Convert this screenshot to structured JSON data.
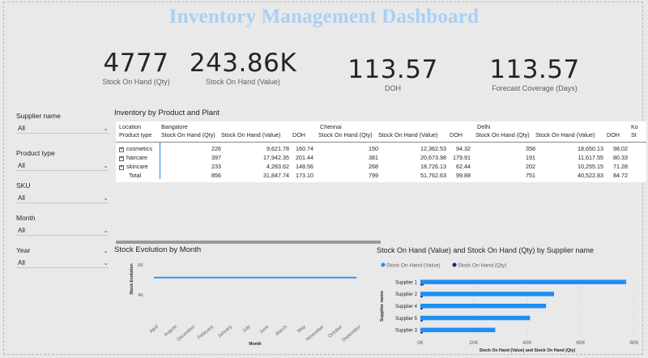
{
  "title": "Inventory Management Dashboard",
  "kpis": [
    {
      "value": "4777",
      "label": "Stock On Hand (Qty)"
    },
    {
      "value": "243.86K",
      "label": "Stock On Hand (Value)"
    },
    {
      "value": "113.57",
      "label": "DOH"
    },
    {
      "value": "113.57",
      "label": "Forecast Coverage (Days)"
    }
  ],
  "slicers": [
    {
      "label": "Supplier name",
      "value": "All"
    },
    {
      "label": "Product type",
      "value": "All"
    },
    {
      "label": "SKU",
      "value": "All"
    },
    {
      "label": "Month",
      "value": "All"
    },
    {
      "label": "Year",
      "value": "All"
    }
  ],
  "matrix": {
    "title": "Inventory by Product and Plant",
    "row_header_top": "Location",
    "row_header": "Product type",
    "plants": [
      "Bangalore",
      "Chennai",
      "Delhi",
      "Ko"
    ],
    "measures": [
      "Stock On Hand (Qty)",
      "Stock On Hand (Value)",
      "DOH"
    ],
    "cutoff_measure": "St",
    "rows": [
      {
        "name": "cosmetics",
        "cells": [
          "226",
          "9,621.78",
          "160.74",
          "150",
          "12,362.53",
          "94.32",
          "358",
          "18,650.13",
          "98.02"
        ]
      },
      {
        "name": "haircare",
        "cells": [
          "397",
          "17,942.35",
          "201.44",
          "381",
          "20,673.98",
          "179.91",
          "191",
          "11,617.55",
          "80.33"
        ]
      },
      {
        "name": "skincare",
        "cells": [
          "233",
          "4,283.62",
          "148.56",
          "268",
          "18,726.13",
          "62.44",
          "202",
          "10,255.15",
          "71.28"
        ]
      }
    ],
    "total": {
      "name": "Total",
      "cells": [
        "856",
        "31,847.74",
        "173.10",
        "799",
        "51,762.63",
        "99.88",
        "751",
        "40,522.83",
        "84.72"
      ]
    }
  },
  "stock_evolution": {
    "title": "Stock Evolution by Month",
    "xlabel": "Month",
    "ylabel": "Stock Evolution"
  },
  "supplier_chart": {
    "title": "Stock On Hand (Value) and Stock On Hand (Qty) by Supplier name",
    "legend": [
      "Stock On Hand (Value)",
      "Stock On Hand (Qty)"
    ],
    "xlabel": "Stock On Hand (Value) and Stock On Hand (Qty)",
    "ylabel": "Supplier name"
  },
  "chart_data": [
    {
      "type": "line",
      "title": "Stock Evolution by Month",
      "xlabel": "Month",
      "ylabel": "Stock Evolution",
      "x": [
        "April",
        "August",
        "December",
        "February",
        "January",
        "July",
        "June",
        "March",
        "May",
        "November",
        "October",
        "September"
      ],
      "series": [
        {
          "values": [
            5100,
            5100,
            5100,
            5100,
            5100,
            5100,
            5100,
            5100,
            5100,
            5100,
            5100,
            5100
          ]
        }
      ],
      "yticks": [
        "4K",
        "6K"
      ],
      "ylim": [
        3800,
        6200
      ],
      "color": "#2b8ff0"
    },
    {
      "type": "bar",
      "orientation": "horizontal",
      "title": "Stock On Hand (Value) and Stock On Hand (Qty) by Supplier name",
      "xlabel": "Stock On Hand (Value) and Stock On Hand (Qty)",
      "ylabel": "Supplier name",
      "categories": [
        "Supplier 1",
        "Supplier 2",
        "Supplier 4",
        "Supplier 5",
        "Supplier 3"
      ],
      "series": [
        {
          "name": "Stock On Hand (Value)",
          "values": [
            77000,
            50000,
            47000,
            41000,
            28000
          ],
          "color": "#1d8ff2"
        },
        {
          "name": "Stock On Hand (Qty)",
          "values": [
            1200,
            900,
            850,
            900,
            900
          ],
          "color": "#12239e"
        }
      ],
      "xticks": [
        "0K",
        "20K",
        "40K",
        "60K",
        "80K"
      ],
      "xlim": [
        0,
        80000
      ],
      "legend": "top-left"
    }
  ]
}
